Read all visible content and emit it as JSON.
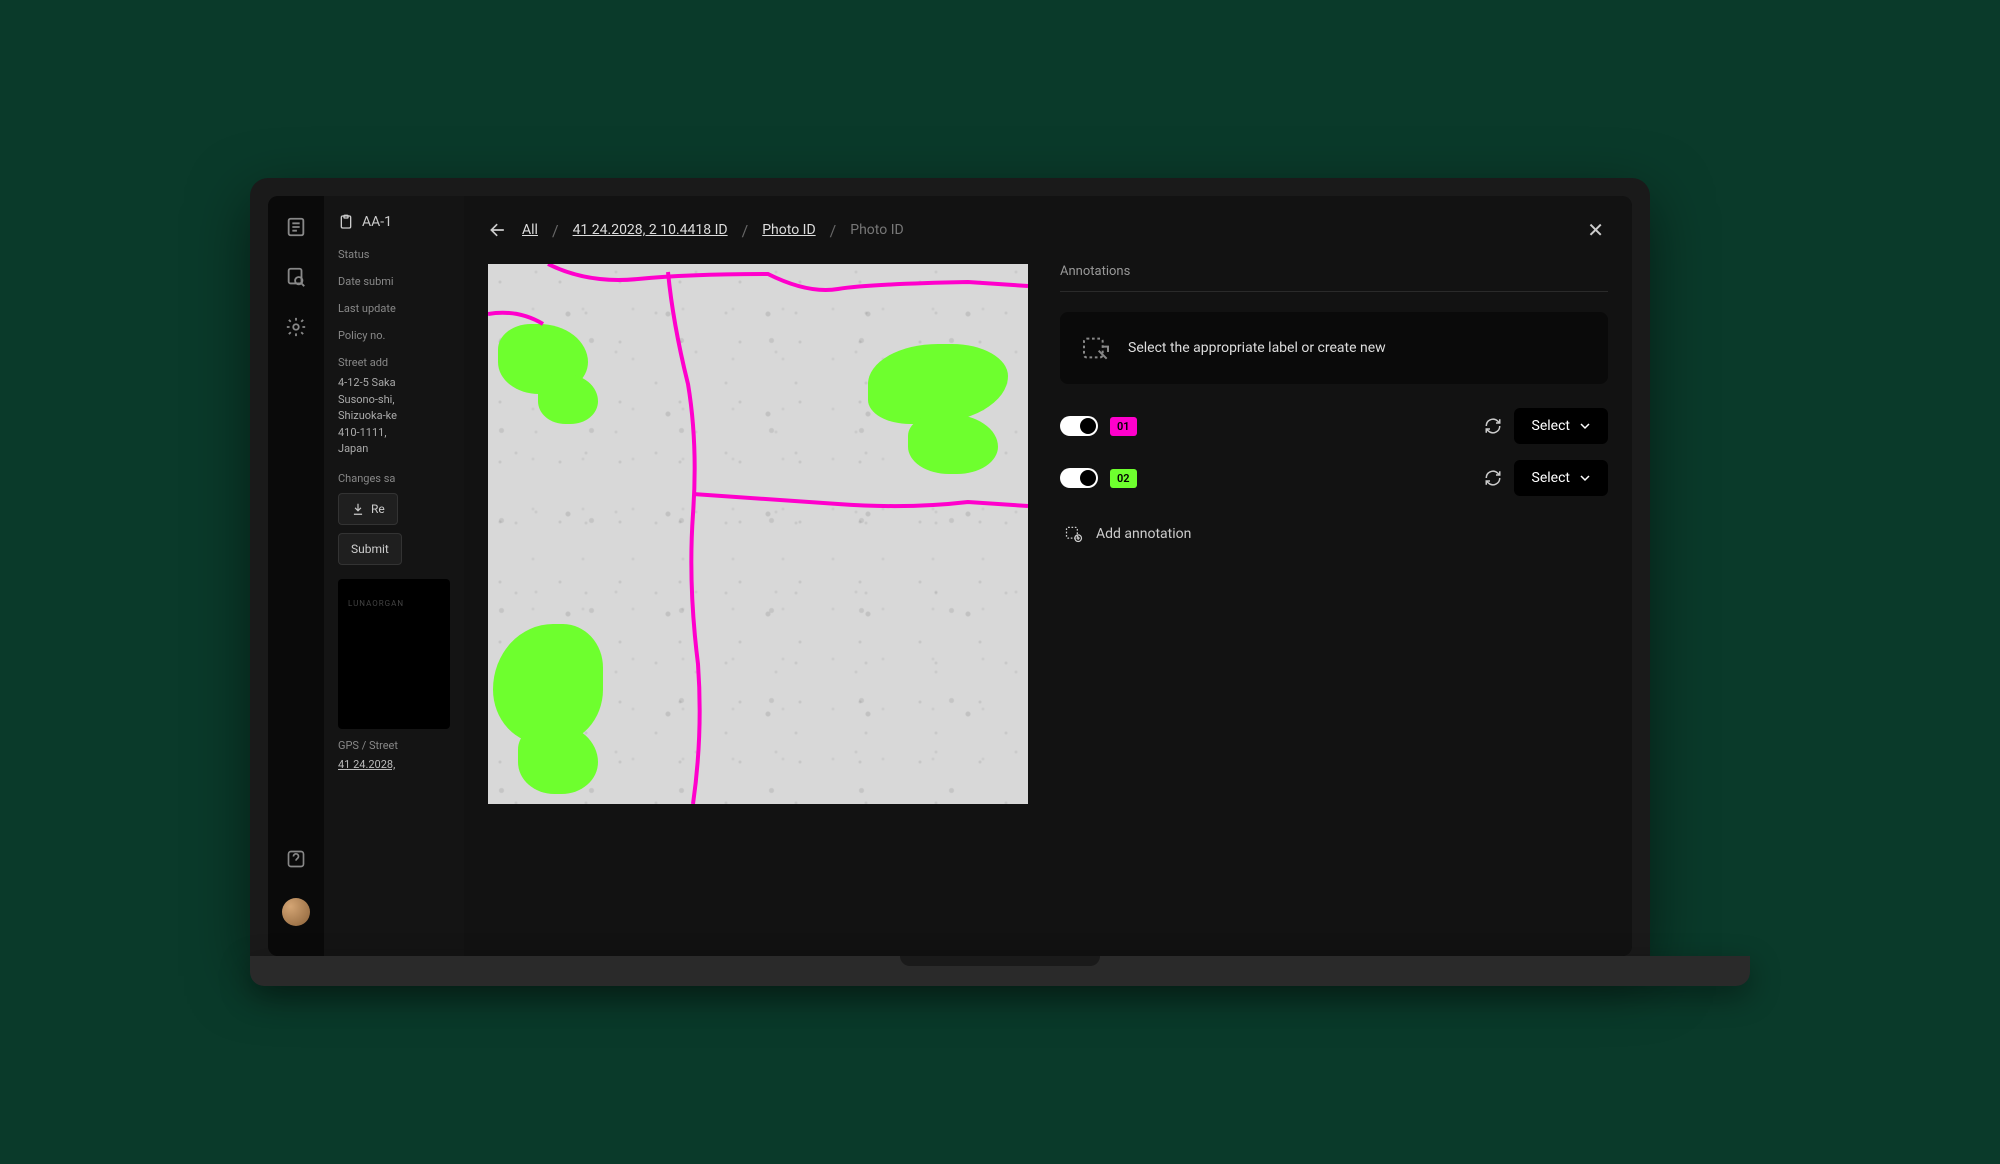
{
  "sidebar": {
    "doc_id": "AA-1",
    "labels": {
      "status": "Status",
      "date_submitted": "Date submi",
      "last_updated": "Last update",
      "policy_no": "Policy no.",
      "street_address": "Street add",
      "changes": "Changes sa",
      "gps": "GPS / Street"
    },
    "address_lines": [
      "4-12-5 Saka",
      "Susono-shi,",
      "Shizuoka-ke",
      "410-1111,",
      "Japan"
    ],
    "gps_link": "41 24.2028,",
    "buttons": {
      "download": "Re",
      "submit": "Submit"
    }
  },
  "breadcrumb": {
    "items": [
      "All",
      "41 24.2028, 2 10.4418  ID",
      "Photo ID"
    ],
    "current": "Photo ID"
  },
  "annotations": {
    "title": "Annotations",
    "hint": "Select the appropriate label or create new",
    "rows": [
      {
        "id": "01",
        "color": "pink",
        "select": "Select"
      },
      {
        "id": "02",
        "color": "green",
        "select": "Select"
      }
    ],
    "add_label": "Add annotation",
    "select_label": "Select"
  }
}
